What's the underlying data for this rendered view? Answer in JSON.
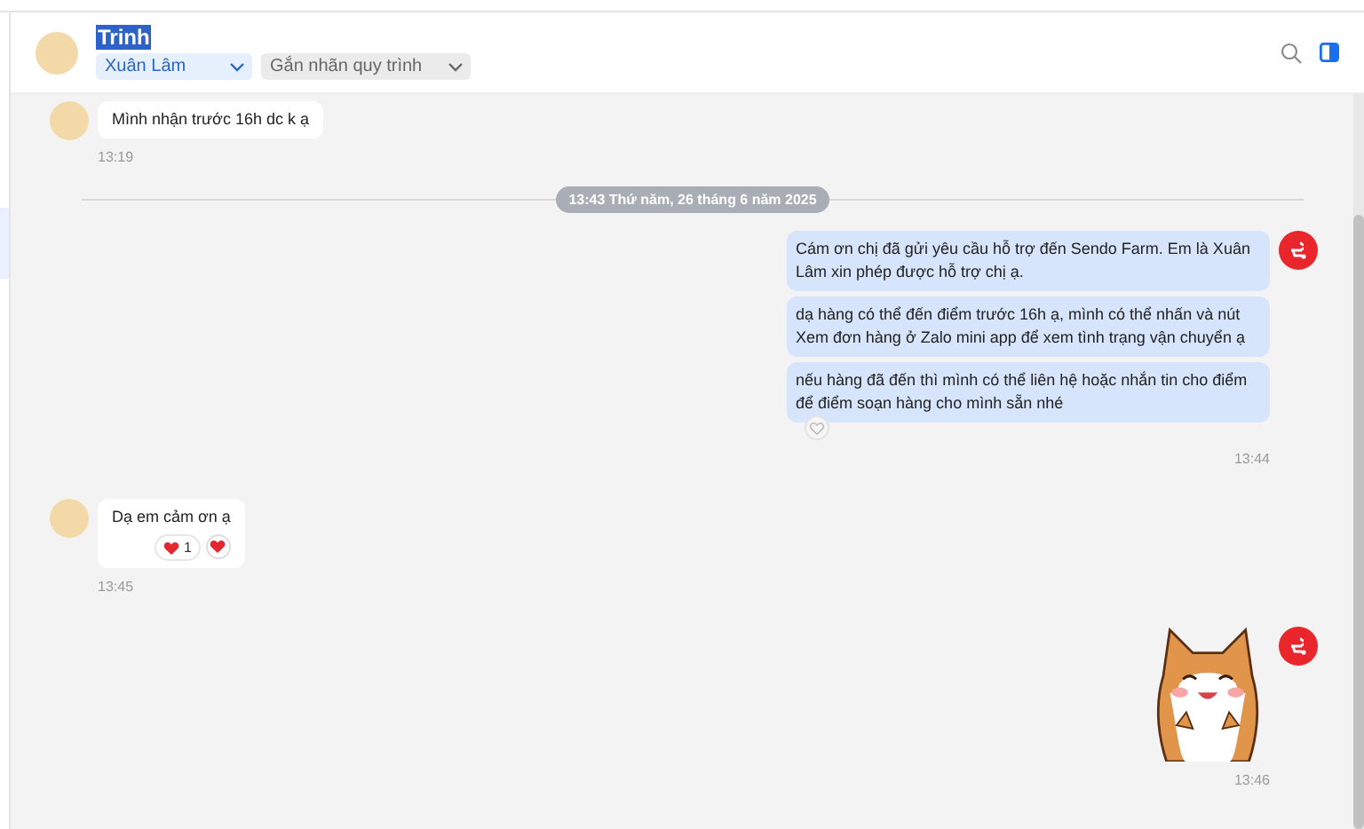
{
  "header": {
    "contact_name": {
      "text": "Trinh",
      "highlighted": true
    },
    "assignee_dropdown": {
      "value": "Xuân Lâm"
    },
    "label_dropdown": {
      "placeholder": "Gắn nhãn quy trình"
    }
  },
  "messages": [
    {
      "kind": "text",
      "outgoing": false,
      "bubbles": [
        "Mình nhận trước 16h dc k ạ"
      ],
      "time": "13:19"
    },
    {
      "kind": "divider",
      "label": "13:43 Thứ năm, 26 tháng 6 năm 2025"
    },
    {
      "kind": "text",
      "outgoing": true,
      "bubbles": [
        "Cám ơn chị đã gửi yêu cầu hỗ trợ đến Sendo Farm. Em là Xuân Lâm xin phép được hỗ trợ chị ạ.",
        "dạ hàng có thể đến điểm trước 16h ạ, mình có thể nhấn và nút Xem đơn hàng ở Zalo mini app để xem tình trạng vận chuyển ạ",
        "nếu hàng đã đến thì mình có thể liên hệ hoặc nhắn tin cho điểm để điểm soạn hàng cho mình sẵn nhé"
      ],
      "time": "13:44"
    },
    {
      "kind": "text",
      "outgoing": false,
      "bubbles": [
        "Dạ em cảm ơn ạ"
      ],
      "reaction_count": "1",
      "time": "13:45"
    },
    {
      "kind": "sticker",
      "outgoing": true,
      "time": "13:46"
    }
  ]
}
